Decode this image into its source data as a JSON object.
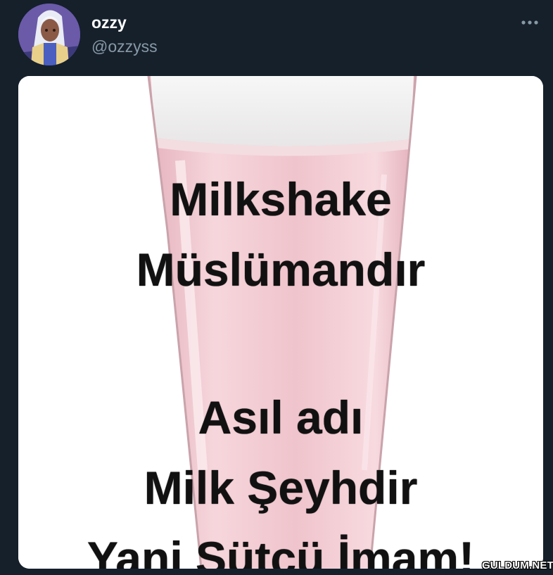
{
  "tweet": {
    "author_name": "ozzy",
    "author_handle": "@ozzyss",
    "more_icon": "more-horizontal-icon",
    "avatar_icon": "avatar-anime-character",
    "media": {
      "lines": [
        "Milkshake",
        "Müslümandır",
        "Asıl adı",
        "Milk Şeyhdir",
        "Yani Sütçü İmam!"
      ]
    }
  },
  "watermark": "GULDUM.NET",
  "colors": {
    "background": "#15202b",
    "name": "#ffffff",
    "handle": "#8899a6",
    "milk": "#f2c9d0"
  }
}
